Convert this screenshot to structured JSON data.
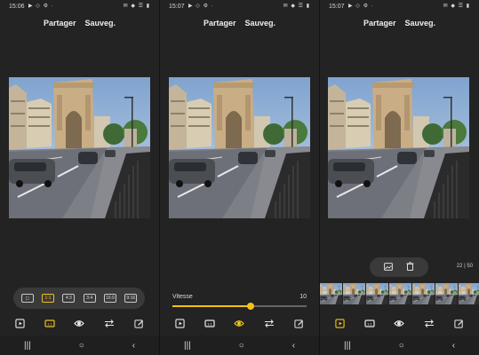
{
  "panels": [
    {
      "status": {
        "time": "15:06",
        "left_icons": "▶ ◇ ⚙ ·",
        "right_icons": "✉ ◆ ☰ ▮"
      },
      "topbar": {
        "share_label": "Partager",
        "save_label": "Sauveg."
      },
      "mode": "crop-ratio",
      "ratio_options": [
        {
          "label": "◻",
          "icon": "free-ratio-icon",
          "active": false
        },
        {
          "label": "1:1",
          "icon": "ratio-1-1-icon",
          "active": true
        },
        {
          "label": "4:3",
          "icon": "ratio-4-3-icon",
          "active": false
        },
        {
          "label": "3:4",
          "icon": "ratio-3-4-icon",
          "active": false
        },
        {
          "label": "16:9",
          "icon": "ratio-16-9-icon",
          "active": false
        },
        {
          "label": "9:16",
          "icon": "ratio-9-16-icon",
          "active": false
        }
      ],
      "active_tool": "ratio"
    },
    {
      "status": {
        "time": "15:07",
        "left_icons": "▶ ◇ ⚙ ·",
        "right_icons": "✉ ◆ ☰ ▮"
      },
      "topbar": {
        "share_label": "Partager",
        "save_label": "Sauveg."
      },
      "mode": "speed",
      "speed": {
        "label": "Vitesse",
        "value": "10",
        "fraction": 0.58
      },
      "active_tool": "effect"
    },
    {
      "status": {
        "time": "15:07",
        "left_icons": "▶ ◇ ⚙ ·",
        "right_icons": "✉ ◆ ☰ ▮"
      },
      "topbar": {
        "share_label": "Partager",
        "save_label": "Sauveg."
      },
      "mode": "frames",
      "counter": "22 | 50",
      "selected_thumb": 3,
      "active_tool": "play"
    }
  ],
  "tools": [
    {
      "name": "play",
      "icon": "play-icon"
    },
    {
      "name": "ratio",
      "icon": "ratio-icon"
    },
    {
      "name": "effect",
      "icon": "eye-icon"
    },
    {
      "name": "direction",
      "icon": "swap-arrows-icon"
    },
    {
      "name": "draw",
      "icon": "edit-pen-icon"
    }
  ],
  "nav": {
    "recents": "|||",
    "home": "○",
    "back": "‹"
  },
  "colors": {
    "accent": "#f0c21b",
    "background": "#232323",
    "tray": "#3a3a3a"
  }
}
